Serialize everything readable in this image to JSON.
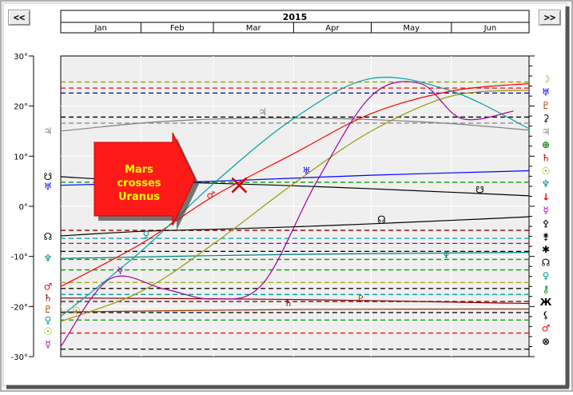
{
  "nav": {
    "prev_label": "<<",
    "next_label": ">>"
  },
  "chart_data": {
    "type": "line",
    "title": "2015",
    "x_months": [
      "Jan",
      "Feb",
      "Mar",
      "Apr",
      "May",
      "Jun"
    ],
    "x_range": [
      "2015-01-01",
      "2015-07-01"
    ],
    "ylim": [
      -30,
      30
    ],
    "y_ticks": [
      30,
      20,
      10,
      0,
      -10,
      -20,
      -30
    ],
    "y_tick_labels": [
      "30°",
      "20°",
      "10°",
      "0°",
      "-10°",
      "-20°",
      "-30°"
    ],
    "grid": true,
    "annotation": {
      "text_lines": [
        "Mars",
        "crosses",
        "Uranus"
      ],
      "cross_date": "2015-03-11",
      "cross_value": 4.2
    },
    "series": [
      {
        "glyph": "♃",
        "color": "#808080",
        "x": [
          "2015-01-01",
          "2015-02-01",
          "2015-03-01",
          "2015-04-01",
          "2015-05-01",
          "2015-06-01",
          "2015-07-01"
        ],
        "y": [
          15.0,
          16.6,
          17.4,
          17.6,
          17.3,
          16.5,
          15.2
        ]
      },
      {
        "glyph": "♅",
        "color": "#0000ff",
        "x": [
          "2015-01-01",
          "2015-03-01",
          "2015-05-01",
          "2015-07-01"
        ],
        "y": [
          4.2,
          5.0,
          6.2,
          7.1
        ]
      },
      {
        "glyph": "☋",
        "color": "#000000",
        "x": [
          "2015-01-01",
          "2015-02-01",
          "2015-03-01",
          "2015-04-01",
          "2015-05-01",
          "2015-06-01",
          "2015-07-01"
        ],
        "y": [
          5.9,
          5.0,
          4.6,
          4.1,
          3.5,
          2.8,
          2.1
        ]
      },
      {
        "glyph": "☊",
        "color": "#000000",
        "x": [
          "2015-01-01",
          "2015-02-01",
          "2015-03-01",
          "2015-04-01",
          "2015-05-01",
          "2015-06-01",
          "2015-07-01"
        ],
        "y": [
          -5.9,
          -5.0,
          -4.6,
          -4.1,
          -3.5,
          -2.8,
          -2.1
        ]
      },
      {
        "glyph": "♆",
        "color": "#008080",
        "x": [
          "2015-01-01",
          "2015-04-01",
          "2015-07-01"
        ],
        "y": [
          -10.4,
          -9.6,
          -9.2
        ]
      },
      {
        "glyph": "♄",
        "color": "#8b0000",
        "x": [
          "2015-01-01",
          "2015-04-01",
          "2015-07-01"
        ],
        "y": [
          -18.3,
          -18.6,
          -19.4
        ]
      },
      {
        "glyph": "♇",
        "color": "#993300",
        "x": [
          "2015-01-01",
          "2015-04-01",
          "2015-07-01"
        ],
        "y": [
          -21.1,
          -20.6,
          -20.5
        ]
      },
      {
        "glyph": "♂",
        "color": "#ff0000",
        "x": [
          "2015-01-01",
          "2015-02-01",
          "2015-03-01",
          "2015-04-01",
          "2015-05-01",
          "2015-06-01",
          "2015-07-01"
        ],
        "y": [
          -16.0,
          -7.5,
          2.0,
          10.5,
          18.5,
          23.0,
          24.5
        ]
      },
      {
        "glyph": "☉",
        "color": "#999900",
        "x": [
          "2015-01-01",
          "2015-02-01",
          "2015-03-01",
          "2015-04-01",
          "2015-05-01",
          "2015-06-01",
          "2015-07-01"
        ],
        "y": [
          -23.0,
          -17.0,
          -7.5,
          4.5,
          15.0,
          22.0,
          23.2
        ]
      },
      {
        "glyph": "♀",
        "color": "#00a0a0",
        "x": [
          "2015-01-01",
          "2015-02-01",
          "2015-03-01",
          "2015-04-01",
          "2015-05-01",
          "2015-06-01",
          "2015-07-01"
        ],
        "y": [
          -22.0,
          -9.0,
          4.5,
          17.5,
          25.5,
          23.0,
          15.5
        ]
      },
      {
        "glyph": "☿",
        "color": "#a000a0",
        "x": [
          "2015-01-01",
          "2015-01-20",
          "2015-02-10",
          "2015-03-01",
          "2015-03-20",
          "2015-04-10",
          "2015-05-01",
          "2015-05-20",
          "2015-06-05",
          "2015-06-25"
        ],
        "y": [
          -28.0,
          -14.5,
          -16.5,
          -18.5,
          -15.5,
          5.0,
          22.0,
          24.5,
          17.5,
          19.0
        ]
      }
    ],
    "ref_lines": [
      {
        "value": 24.8,
        "color": "#999900"
      },
      {
        "value": 23.6,
        "color": "#ff0000"
      },
      {
        "value": 22.6,
        "color": "#0000cc"
      },
      {
        "value": 17.8,
        "color": "#000000"
      },
      {
        "value": 16.6,
        "color": "#808080"
      },
      {
        "value": 4.8,
        "color": "#00a000"
      },
      {
        "value": -4.8,
        "color": "#8b0000"
      },
      {
        "value": -6.4,
        "color": "#00a0a0"
      },
      {
        "value": -7.4,
        "color": "#a000a0"
      },
      {
        "value": -9.0,
        "color": "#000000"
      },
      {
        "value": -10.6,
        "color": "#00a000"
      },
      {
        "value": -12.7,
        "color": "#00a000"
      },
      {
        "value": -15.2,
        "color": "#a0a000"
      },
      {
        "value": -16.4,
        "color": "#000000"
      },
      {
        "value": -17.6,
        "color": "#00a0a0"
      },
      {
        "value": -19.0,
        "color": "#8b0000"
      },
      {
        "value": -21.2,
        "color": "#000000"
      },
      {
        "value": -22.7,
        "color": "#00a000"
      },
      {
        "value": -25.3,
        "color": "#ff0000"
      },
      {
        "value": -28.5,
        "color": "#000000"
      }
    ],
    "right_glyphs": [
      {
        "glyph": "☽",
        "color": "#999900"
      },
      {
        "glyph": "♅",
        "color": "#0000ff"
      },
      {
        "glyph": "♇",
        "color": "#993300"
      },
      {
        "glyph": "⚳",
        "color": "#000000"
      },
      {
        "glyph": "♃",
        "color": "#808080"
      },
      {
        "glyph": "⊕",
        "color": "#008000"
      },
      {
        "glyph": "♄",
        "color": "#8b0000"
      },
      {
        "glyph": "☉",
        "color": "#999900"
      },
      {
        "glyph": "♆",
        "color": "#008080"
      },
      {
        "glyph": "↓",
        "color": "#ff0000"
      },
      {
        "glyph": "☿",
        "color": "#a000a0"
      },
      {
        "glyph": "⚴",
        "color": "#000000"
      },
      {
        "glyph": "⚵",
        "color": "#000000"
      },
      {
        "glyph": "✱",
        "color": "#000000"
      },
      {
        "glyph": "☊",
        "color": "#000000"
      },
      {
        "glyph": "♀",
        "color": "#00a0a0"
      },
      {
        "glyph": "⚷",
        "color": "#008000"
      },
      {
        "glyph": "Ж",
        "color": "#000000"
      },
      {
        "glyph": "⚸",
        "color": "#000000"
      },
      {
        "glyph": "♂",
        "color": "#ff0000"
      },
      {
        "glyph": "⊗",
        "color": "#000000"
      }
    ],
    "left_glyphs": [
      {
        "glyph": "♃",
        "color": "#808080",
        "value": 15.0
      },
      {
        "glyph": "☋",
        "color": "#000000",
        "value": 5.9
      },
      {
        "glyph": "♅",
        "color": "#0000ff",
        "value": 3.9
      },
      {
        "glyph": "☊",
        "color": "#000000",
        "value": -6.1
      },
      {
        "glyph": "♆",
        "color": "#008080",
        "value": -10.4
      },
      {
        "glyph": "♂",
        "color": "#ff0000",
        "value": -16.0
      },
      {
        "glyph": "♄",
        "color": "#8b0000",
        "value": -18.3
      },
      {
        "glyph": "♇",
        "color": "#993300",
        "value": -20.6
      },
      {
        "glyph": "♀",
        "color": "#00a0a0",
        "value": -22.7
      },
      {
        "glyph": "☉",
        "color": "#999900",
        "value": -25.0
      },
      {
        "glyph": "☿",
        "color": "#a000a0",
        "value": -27.5
      }
    ],
    "inline_glyphs": [
      {
        "glyph": "♃",
        "color": "#808080",
        "date": "2015-03-20",
        "value": 18.8
      },
      {
        "glyph": "♅",
        "color": "#0000ff",
        "date": "2015-04-06",
        "value": 7.0
      },
      {
        "glyph": "♂",
        "color": "#ff0000",
        "date": "2015-02-28",
        "value": 2.2
      },
      {
        "glyph": "☋",
        "color": "#000000",
        "date": "2015-06-12",
        "value": 3.3
      },
      {
        "glyph": "☊",
        "color": "#000000",
        "date": "2015-05-05",
        "value": -2.6
      },
      {
        "glyph": "♀",
        "color": "#00a0a0",
        "date": "2015-02-03",
        "value": -5.7
      },
      {
        "glyph": "♆",
        "color": "#008080",
        "date": "2015-05-30",
        "value": -9.7
      },
      {
        "glyph": "☿",
        "color": "#a000a0",
        "date": "2015-01-24",
        "value": -12.8
      },
      {
        "glyph": "♄",
        "color": "#8b0000",
        "date": "2015-03-30",
        "value": -19.3
      },
      {
        "glyph": "♇",
        "color": "#993300",
        "date": "2015-04-27",
        "value": -18.5
      },
      {
        "glyph": "☉",
        "color": "#999900",
        "date": "2015-01-07",
        "value": -20.8
      }
    ]
  }
}
